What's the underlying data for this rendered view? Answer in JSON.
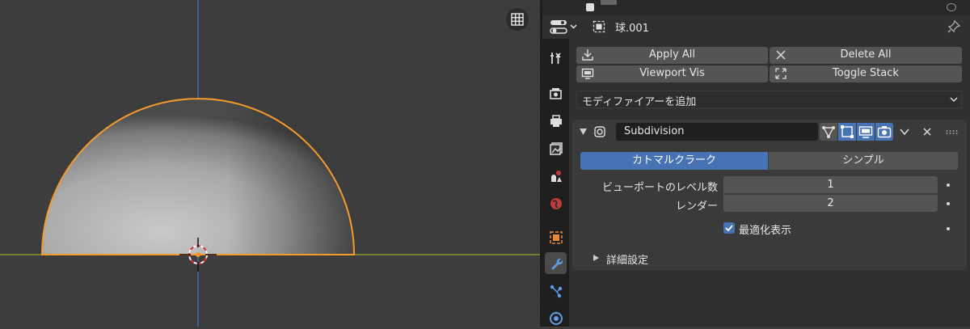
{
  "properties": {
    "object_name": "球.001",
    "buttons": {
      "apply_all": "Apply All",
      "delete_all": "Delete All",
      "viewport_vis": "Viewport Vis",
      "toggle_stack": "Toggle Stack"
    },
    "add_modifier": "モディファイアーを追加",
    "modifier": {
      "name": "Subdivision",
      "mode_catmull": "カトマルクラーク",
      "mode_simple": "シンプル",
      "viewport_levels_label": "ビューポートのレベル数",
      "viewport_levels_value": "1",
      "render_label": "レンダー",
      "render_value": "2",
      "optimal_display_label": "最適化表示",
      "optimal_display_checked": true,
      "advanced_label": "詳細設定"
    }
  },
  "icons": {
    "tabs": [
      "tool-icon",
      "render-icon",
      "output-icon",
      "view-layer-icon",
      "scene-icon",
      "world-icon",
      "object-icon",
      "modifier-wrench-icon",
      "particles-icon",
      "physics-icon"
    ],
    "active_tab": "modifier-wrench-icon"
  },
  "colors": {
    "accent_blue": "#4772b3",
    "selection_orange": "#f59a2d",
    "x_axis_green": "#7c9a2d",
    "z_axis_blue": "#3f6fb5"
  }
}
